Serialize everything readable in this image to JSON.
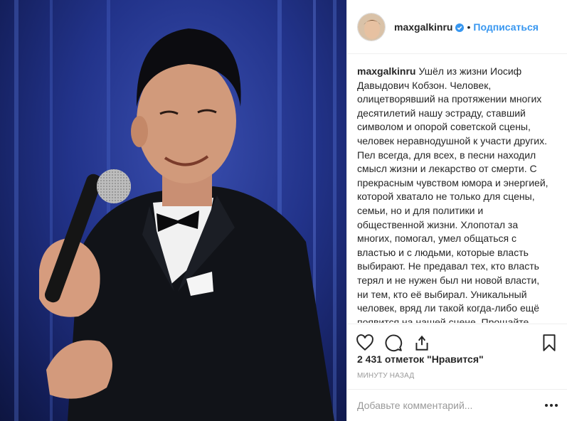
{
  "post": {
    "username": "maxgalkinru",
    "follow_label": "Подписаться",
    "separator": "•",
    "caption_user": "maxgalkinru",
    "caption_text": "Ушёл из жизни Иосиф Давыдович Кобзон. Человек, олицетворявший на протяжении многих десятилетий нашу эстраду, ставший символом и опорой советской сцены, человек неравнодушной к участи других. Пел всегда, для всех, в песни находил смысл жизни и лекарство от смерти. С прекрасным чувством юмора и энергией, которой хватало не только для сцены, семьи, но и для политики и общественной жизни. Хлопотал за многих, помогал, умел общаться с властью и с людьми, которые власть выбирают. Не предавал тех, кто власть терял и не нужен был ни новой власти, ни тем, кто её выбирал. Уникальный человек, вряд ли такой когда-либо ещё появится на нашей сцене. Прощайте, Иосиф Давыдович! Царствие Вам небесное!",
    "likes": "2 431 отметок \"Нравится\"",
    "time": "МИНУТУ НАЗАД",
    "comment_placeholder": "Добавьте комментарий..."
  },
  "icons": {
    "verified": "verified-badge-icon",
    "like": "heart-icon",
    "comment": "comment-icon",
    "share": "share-icon",
    "save": "bookmark-icon",
    "more": "more-options-icon"
  },
  "colors": {
    "link_blue": "#3897f0",
    "text": "#262626",
    "muted": "#999999",
    "border": "#efefef",
    "stage_blue": "#22338a"
  }
}
